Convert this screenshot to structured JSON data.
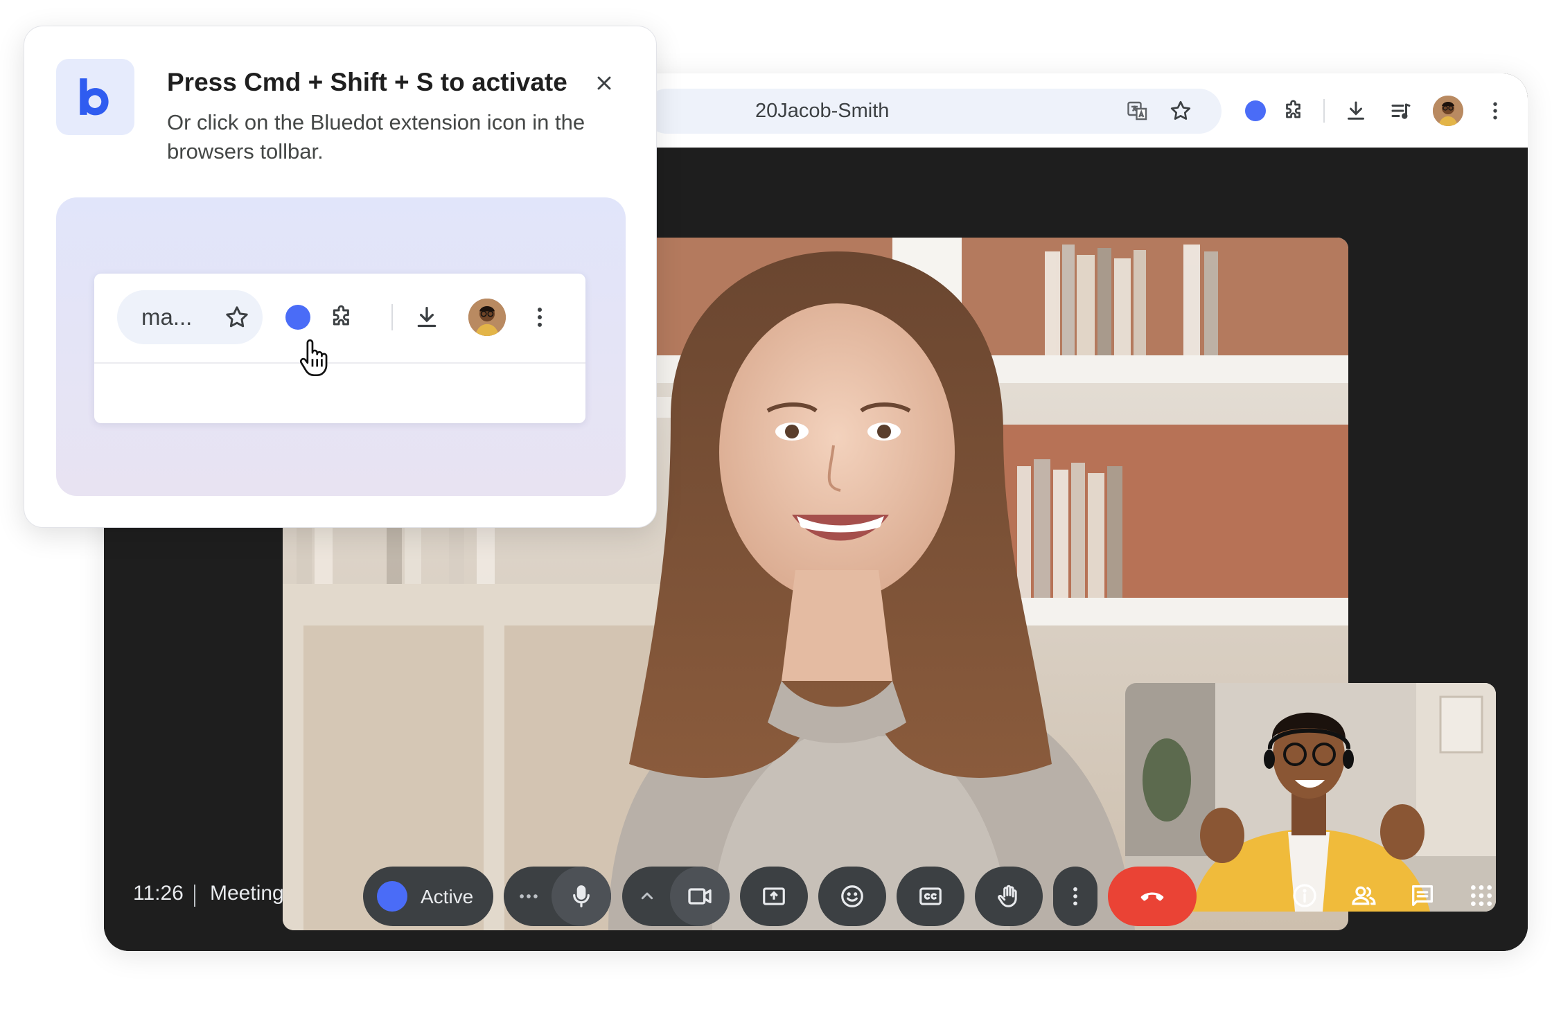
{
  "browser": {
    "url_fragment": "20Jacob-Smith",
    "toolbar_icons": [
      "translate-icon",
      "star-icon",
      "bluedot-extension-icon",
      "puzzle-icon",
      "download-icon",
      "media-control-icon",
      "profile-avatar",
      "more-vert-icon"
    ]
  },
  "meet": {
    "time": "11:26",
    "meeting_name": "Meeting",
    "active_label": "Active",
    "controls": [
      "more-horiz-icon",
      "mic-icon",
      "chevron-up-icon",
      "camera-icon",
      "present-icon",
      "emoji-icon",
      "captions-icon",
      "raise-hand-icon",
      "more-vert-icon",
      "end-call-icon"
    ],
    "right_icons": [
      "info-icon",
      "people-icon",
      "chat-icon",
      "apps-grid-icon"
    ]
  },
  "popup": {
    "title": "Press Cmd + Shift + S to activate",
    "description": "Or click on the Bluedot extension icon in the browsers tollbar.",
    "mini_toolbar_text": "ma..."
  },
  "colors": {
    "accent": "#4a6cf7",
    "end_call": "#ea4335",
    "meet_bg": "#1e1e1e",
    "control_bg": "#3c4043"
  }
}
